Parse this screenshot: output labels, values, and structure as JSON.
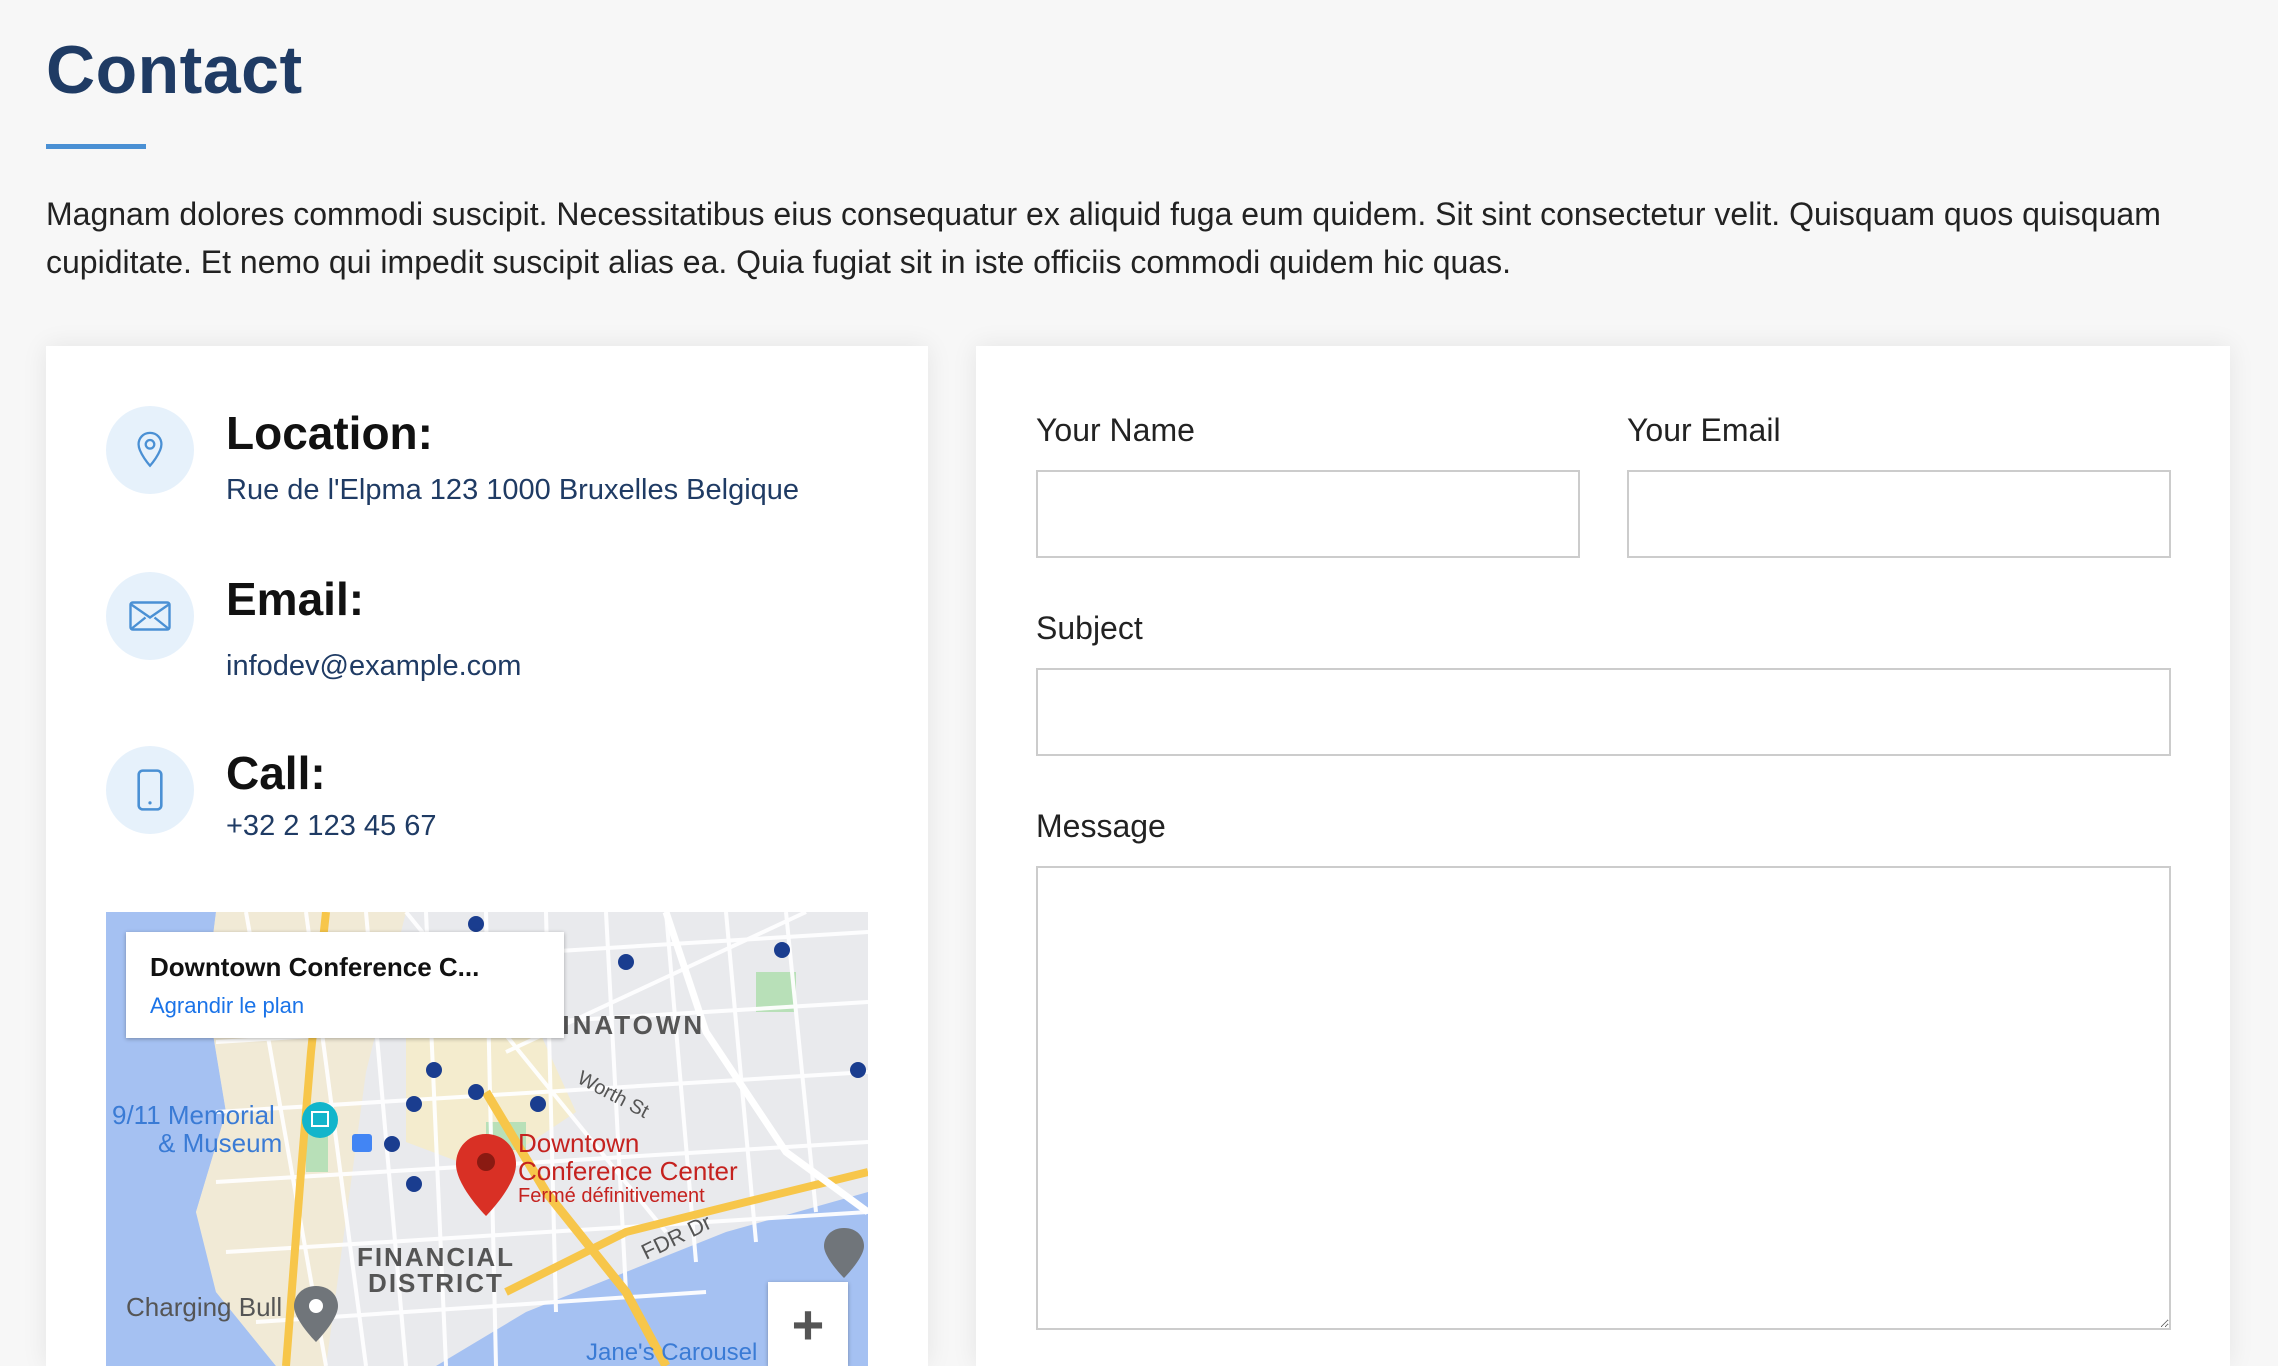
{
  "header": {
    "title": "Contact",
    "description": "Magnam dolores commodi suscipit. Necessitatibus eius consequatur ex aliquid fuga eum quidem. Sit sint consectetur velit. Quisquam quos quisquam cupiditate. Et nemo qui impedit suscipit alias ea. Quia fugiat sit in iste officiis commodi quidem hic quas."
  },
  "info": {
    "location": {
      "heading": "Location:",
      "text": "Rue de l'Elpma 123 1000 Bruxelles Belgique",
      "icon": "map-pin-icon"
    },
    "email": {
      "heading": "Email:",
      "text": "infodev@example.com",
      "icon": "envelope-icon"
    },
    "call": {
      "heading": "Call:",
      "text": "+32 2 123 45 67",
      "icon": "phone-icon"
    }
  },
  "map": {
    "popup_title": "Downtown Conference C...",
    "popup_link": "Agrandir le plan",
    "labels": {
      "chinatown": "CHINATOWN",
      "worth_st": "Worth St",
      "memorial_1": "9/11 Memorial",
      "memorial_2": "& Museum",
      "venue_1": "Downtown",
      "venue_2": "Conference Center",
      "venue_status": "Fermé définitivement",
      "financial_1": "FINANCIAL",
      "financial_2": "DISTRICT",
      "fdr": "FDR Dr",
      "bull": "Charging Bull",
      "carousel": "Jane's Carousel"
    },
    "zoom_in": "+"
  },
  "form": {
    "name_label": "Your Name",
    "email_label": "Your Email",
    "subject_label": "Subject",
    "message_label": "Message",
    "name_value": "",
    "email_value": "",
    "subject_value": "",
    "message_value": ""
  },
  "colors": {
    "title": "#1f3b64",
    "accent": "#4a90d4",
    "icon_bg": "#e6f1fb",
    "link": "#1a73e8",
    "marker": "#d93025"
  }
}
